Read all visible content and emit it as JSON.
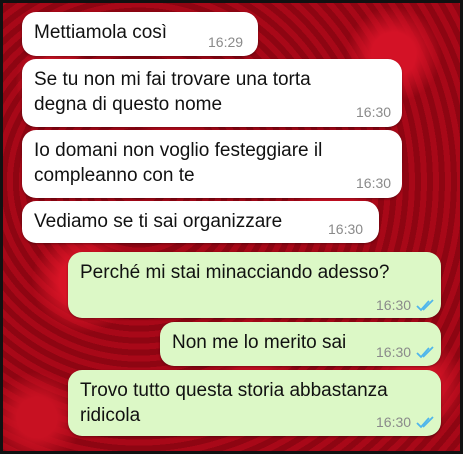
{
  "colors": {
    "incoming_bubble": "#ffffff",
    "outgoing_bubble": "#dcf8c6",
    "read_ticks": "#4fb6ec",
    "timestamp": "#8a8a8a"
  },
  "messages": [
    {
      "direction": "incoming",
      "lines": [
        "Mettiamola così"
      ],
      "time": "16:29"
    },
    {
      "direction": "incoming",
      "lines": [
        "Se tu non mi fai trovare una torta",
        "degna di questo nome"
      ],
      "time": "16:30"
    },
    {
      "direction": "incoming",
      "lines": [
        "Io domani non voglio festeggiare il",
        "compleanno con te"
      ],
      "time": "16:30"
    },
    {
      "direction": "incoming",
      "lines": [
        "Vediamo se ti sai organizzare"
      ],
      "time": "16:30"
    },
    {
      "direction": "outgoing",
      "lines": [
        "Perché mi stai minacciando adesso?"
      ],
      "time": "16:30",
      "status_icon": "double-check-read-icon"
    },
    {
      "direction": "outgoing",
      "lines": [
        "Non me lo merito sai"
      ],
      "time": "16:30",
      "status_icon": "double-check-read-icon"
    },
    {
      "direction": "outgoing",
      "lines": [
        "Trovo tutto questa storia abbastanza",
        "ridicola"
      ],
      "time": "16:30",
      "status_icon": "double-check-read-icon"
    }
  ]
}
